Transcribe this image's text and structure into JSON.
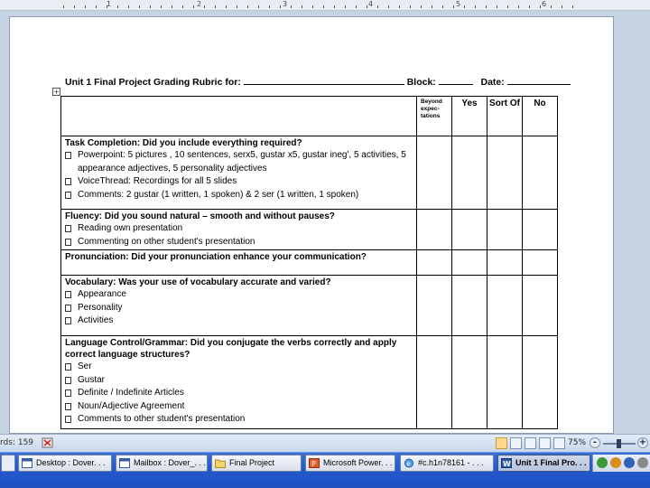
{
  "ruler": {
    "numbers": [
      "1",
      "2",
      "3",
      "4",
      "5",
      "6"
    ]
  },
  "document": {
    "heading": {
      "prefix": "Unit 1 Final Project Grading Rubric for:",
      "block_label": "Block:",
      "date_label": "Date:"
    },
    "columns": {
      "beyond": "Beyond expec-tations",
      "yes": "Yes",
      "sort_of": "Sort Of",
      "no": "No"
    },
    "rows": [
      {
        "title": "Task Completion:  Did you include everything required?",
        "items": [
          "Powerpoint: 5 pictures , 10 sentences, serx5, gustar x5,  gustar ineg', 5 activities, 5 appearance adjectives, 5 personality adjectives",
          "VoiceThread: Recordings for all 5 slides",
          "Comments: 2 gustar (1 written, 1 spoken)  & 2 ser (1 written, 1 spoken)"
        ]
      },
      {
        "title": "Fluency:   Did you sound natural – smooth and without pauses?",
        "items": [
          "Reading own presentation",
          "Commenting on other student's presentation"
        ]
      },
      {
        "title": "Pronunciation:  Did your pronunciation enhance your communication?",
        "items": []
      },
      {
        "title": "Vocabulary:   Was your use of vocabulary accurate and varied?",
        "items": [
          "Appearance",
          "Personality",
          "Activities"
        ]
      },
      {
        "title": "Language Control/Grammar: Did you conjugate the verbs correctly and apply correct language structures?",
        "items": [
          "Ser",
          "Gustar",
          "Definite / Indefinite Articles",
          "Noun/Adjective Agreement",
          "Comments to other student's presentation"
        ]
      }
    ]
  },
  "status_bar": {
    "words": "rds: 159",
    "zoom": "75%",
    "minus": "-",
    "plus": "+"
  },
  "taskbar": {
    "tasks": [
      "Desktop : Dover. . .",
      "Mailbox : Dover_. . .",
      "Final Project",
      "Microsoft Power. . .",
      "#c.h1n78161 - . . .",
      "Unit 1 Final Pro. . ."
    ]
  },
  "colors": {
    "taskbar": "#245bd0",
    "page_bg": "#ffffff",
    "app_bg": "#c6d3e3"
  }
}
